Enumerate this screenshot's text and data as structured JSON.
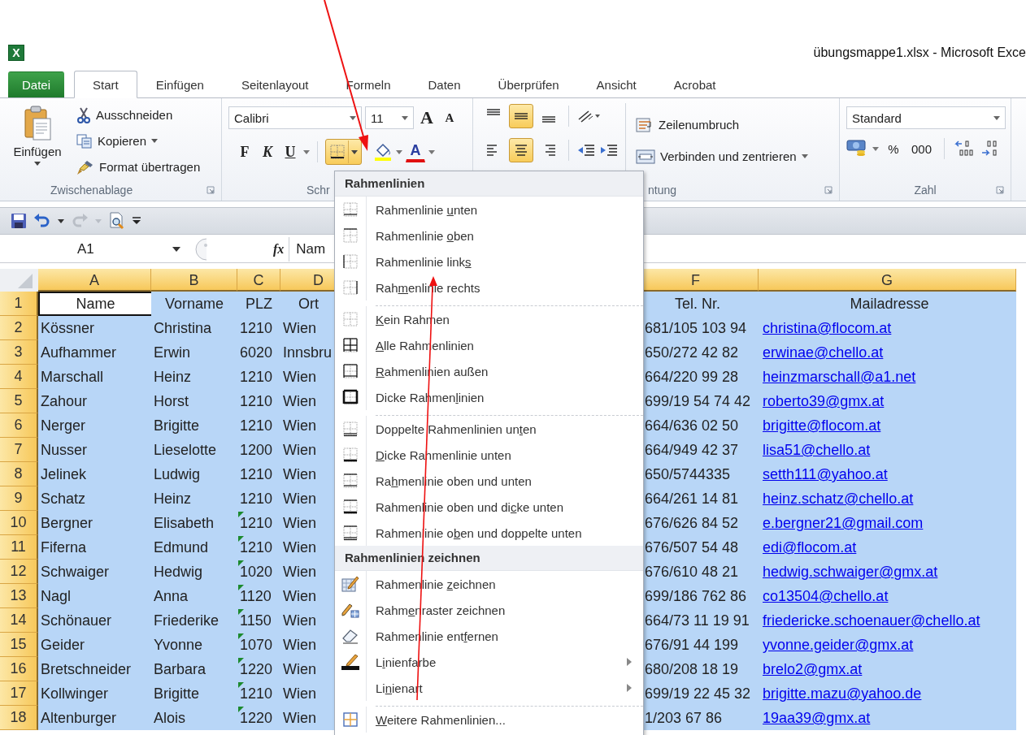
{
  "window": {
    "app_letter": "X",
    "title": "übungsmappe1.xlsx  -  Microsoft Exce"
  },
  "tabs": [
    {
      "label": "Datei",
      "kind": "file",
      "selected": false
    },
    {
      "label": "Start",
      "kind": "tab",
      "selected": true
    },
    {
      "label": "Einfügen",
      "kind": "tab",
      "selected": false
    },
    {
      "label": "Seitenlayout",
      "kind": "tab",
      "selected": false
    },
    {
      "label": "Formeln",
      "kind": "tab",
      "selected": false
    },
    {
      "label": "Daten",
      "kind": "tab",
      "selected": false
    },
    {
      "label": "Überprüfen",
      "kind": "tab",
      "selected": false
    },
    {
      "label": "Ansicht",
      "kind": "tab",
      "selected": false
    },
    {
      "label": "Acrobat",
      "kind": "tab",
      "selected": false
    }
  ],
  "clipboard": {
    "paste": "Einfügen",
    "cut": "Ausschneiden",
    "copy": "Kopieren",
    "format_painter": "Format übertragen",
    "label": "Zwischenablage"
  },
  "font": {
    "family": "Calibri",
    "size": "11",
    "grow": "A",
    "shrink": "A",
    "bold": "F",
    "italic": "K",
    "underline": "U",
    "font_color": "A",
    "borders_open": true,
    "label": "Schr"
  },
  "alignment": {
    "vertical": [
      {
        "kind": "top",
        "selected": false
      },
      {
        "kind": "middle",
        "selected": true
      },
      {
        "kind": "bottom",
        "selected": false
      }
    ],
    "horizontal": [
      {
        "kind": "left",
        "selected": false
      },
      {
        "kind": "center",
        "selected": true
      },
      {
        "kind": "right",
        "selected": false
      }
    ],
    "wrap": "Zeilenumbruch",
    "merge": "Verbinden und zentrieren",
    "label": "ntung"
  },
  "number": {
    "format": "Standard",
    "percent": "%",
    "thousands": "000",
    "label": "Zahl"
  },
  "formula_bar": {
    "name_box": "A1",
    "fx": "fx",
    "value": "Nam"
  },
  "sheet": {
    "columns": [
      {
        "label": "A",
        "kind": "text"
      },
      {
        "label": "B",
        "kind": "text"
      },
      {
        "label": "C",
        "kind": "text"
      },
      {
        "label": "D",
        "kind": "text"
      },
      {
        "label": "F",
        "kind": "text"
      },
      {
        "label": "G",
        "kind": "link"
      }
    ],
    "rows": [
      {
        "label": "1",
        "kind": "header",
        "first_cell_active": true,
        "plz_flag": false,
        "cells": [
          "Name",
          "Vorname",
          "PLZ",
          "Ort",
          "Tel. Nr.",
          "Mailadresse"
        ]
      },
      {
        "label": "2",
        "kind": "data",
        "first_cell_active": false,
        "plz_flag": false,
        "cells": [
          "Kössner",
          "Christina",
          "1210",
          "Wien",
          "681/105 103 94",
          "christina@flocom.at"
        ]
      },
      {
        "label": "3",
        "kind": "data",
        "first_cell_active": false,
        "plz_flag": false,
        "cells": [
          "Aufhammer",
          "Erwin",
          "6020",
          "Innsbru",
          "650/272 42 82",
          "erwinae@chello.at"
        ]
      },
      {
        "label": "4",
        "kind": "data",
        "first_cell_active": false,
        "plz_flag": false,
        "cells": [
          "Marschall",
          "Heinz",
          "1210",
          "Wien",
          "664/220 99 28",
          "heinzmarschall@a1.net"
        ]
      },
      {
        "label": "5",
        "kind": "data",
        "first_cell_active": false,
        "plz_flag": false,
        "cells": [
          "Zahour",
          "Horst",
          "1210",
          "Wien",
          "699/19 54 74 42",
          "roberto39@gmx.at"
        ]
      },
      {
        "label": "6",
        "kind": "data",
        "first_cell_active": false,
        "plz_flag": false,
        "cells": [
          "Nerger",
          "Brigitte",
          "1210",
          "Wien",
          "664/636 02 50",
          "brigitte@flocom.at"
        ]
      },
      {
        "label": "7",
        "kind": "data",
        "first_cell_active": false,
        "plz_flag": false,
        "cells": [
          "Nusser",
          "Lieselotte",
          "1200",
          "Wien",
          "664/949 42 37",
          "lisa51@chello.at"
        ]
      },
      {
        "label": "8",
        "kind": "data",
        "first_cell_active": false,
        "plz_flag": false,
        "cells": [
          "Jelinek",
          "Ludwig",
          "1210",
          "Wien",
          "650/5744335",
          "setth111@yahoo.at"
        ]
      },
      {
        "label": "9",
        "kind": "data",
        "first_cell_active": false,
        "plz_flag": false,
        "cells": [
          "Schatz",
          "Heinz",
          "1210",
          "Wien",
          "664/261 14 81",
          "heinz.schatz@chello.at"
        ]
      },
      {
        "label": "10",
        "kind": "data",
        "first_cell_active": false,
        "plz_flag": true,
        "cells": [
          "Bergner",
          "Elisabeth",
          "1210",
          "Wien",
          "676/626 84 52",
          "e.bergner21@gmail.com"
        ]
      },
      {
        "label": "11",
        "kind": "data",
        "first_cell_active": false,
        "plz_flag": true,
        "cells": [
          "Fiferna",
          "Edmund",
          "1210",
          "Wien",
          "676/507 54 48",
          "edi@flocom.at"
        ]
      },
      {
        "label": "12",
        "kind": "data",
        "first_cell_active": false,
        "plz_flag": true,
        "cells": [
          "Schwaiger",
          "Hedwig",
          "1020",
          "Wien",
          "676/610 48 21",
          "hedwig.schwaiger@gmx.at"
        ]
      },
      {
        "label": "13",
        "kind": "data",
        "first_cell_active": false,
        "plz_flag": true,
        "cells": [
          "Nagl",
          "Anna",
          "1120",
          "Wien",
          "699/186 762 86",
          "co13504@chello.at"
        ]
      },
      {
        "label": "14",
        "kind": "data",
        "first_cell_active": false,
        "plz_flag": true,
        "cells": [
          "Schönauer",
          "Friederike",
          "1150",
          "Wien",
          "664/73 11 19 91",
          "friedericke.schoenauer@chello.at"
        ]
      },
      {
        "label": "15",
        "kind": "data",
        "first_cell_active": false,
        "plz_flag": true,
        "cells": [
          "Geider",
          "Yvonne",
          "1070",
          "Wien",
          "676/91 44 199",
          "yvonne.geider@gmx.at"
        ]
      },
      {
        "label": "16",
        "kind": "data",
        "first_cell_active": false,
        "plz_flag": true,
        "cells": [
          "Bretschneider",
          "Barbara",
          "1220",
          "Wien",
          "680/208 18 19",
          "brelo2@gmx.at"
        ]
      },
      {
        "label": "17",
        "kind": "data",
        "first_cell_active": false,
        "plz_flag": true,
        "cells": [
          "Kollwinger",
          "Brigitte",
          "1210",
          "Wien",
          "699/19 22 45 32",
          "brigitte.mazu@yahoo.de"
        ]
      },
      {
        "label": "18",
        "kind": "data",
        "first_cell_active": false,
        "plz_flag": true,
        "cells": [
          "Altenburger",
          "Alois",
          "1220",
          "Wien",
          "1/203 67 86",
          "19aa39@gmx.at"
        ]
      }
    ]
  },
  "menu": {
    "sections": [
      {
        "title": "Rahmenlinien",
        "items": [
          {
            "kind": "bottom",
            "pre": "Rahmenlinie ",
            "key": "u",
            "post": "nten",
            "separator_before": false,
            "submenu": false
          },
          {
            "kind": "top",
            "pre": "Rahmenlinie ",
            "key": "o",
            "post": "ben",
            "separator_before": false,
            "submenu": false
          },
          {
            "kind": "left",
            "pre": "Rahmenlinie link",
            "key": "s",
            "separator_before": false,
            "submenu": false
          },
          {
            "kind": "right",
            "pre": "Rah",
            "key": "m",
            "post": "enlinie rechts",
            "separator_before": false,
            "submenu": false
          },
          {
            "kind": "none",
            "key": "K",
            "post": "ein Rahmen",
            "separator_before": true,
            "submenu": false
          },
          {
            "kind": "all",
            "key": "A",
            "post": "lle Rahmenlinien",
            "separator_before": false,
            "submenu": false
          },
          {
            "kind": "outside",
            "key": "R",
            "post": "ahmenlinien außen",
            "separator_before": false,
            "submenu": false
          },
          {
            "kind": "thick",
            "pre": "Dicke Rahmen",
            "key": "l",
            "post": "inien",
            "separator_before": false,
            "submenu": false
          },
          {
            "kind": "double-bottom",
            "pre": "Doppelte Rahmenlinien un",
            "key": "t",
            "post": "en",
            "separator_before": true,
            "submenu": false
          },
          {
            "kind": "thick-bottom",
            "key": "D",
            "post": "icke Rahmenlinie unten",
            "separator_before": false,
            "submenu": false
          },
          {
            "kind": "top-bottom",
            "pre": "Ra",
            "key": "h",
            "post": "menlinie oben und unten",
            "separator_before": false,
            "submenu": false
          },
          {
            "kind": "top-thick-bottom",
            "pre": "Rahmenlinie oben und di",
            "key": "c",
            "post": "ke unten",
            "separator_before": false,
            "submenu": false
          },
          {
            "kind": "top-double-bottom",
            "pre": "Rahmenlinie o",
            "key": "b",
            "post": "en und doppelte unten",
            "separator_before": false,
            "submenu": false
          }
        ]
      },
      {
        "title": "Rahmenlinien zeichnen",
        "items": [
          {
            "kind": "draw",
            "pre": "Rahmenlinie ",
            "key": "z",
            "post": "eichnen",
            "separator_before": false,
            "submenu": false
          },
          {
            "kind": "grid",
            "pre": "Rahm",
            "key": "e",
            "post": "nraster zeichnen",
            "separator_before": false,
            "submenu": false
          },
          {
            "kind": "eraser",
            "pre": "Rahmenlinie ent",
            "key": "f",
            "post": "ernen",
            "separator_before": false,
            "submenu": false
          },
          {
            "kind": "line-color",
            "pre": "L",
            "key": "i",
            "post": "nienfarbe",
            "separator_before": false,
            "submenu": true
          },
          {
            "kind": "plain",
            "pre": "Li",
            "key": "n",
            "post": "ienart",
            "separator_before": false,
            "submenu": true
          },
          {
            "kind": "more",
            "key": "W",
            "post": "eitere Rahmenlinien...",
            "separator_before": true,
            "submenu": false
          }
        ]
      }
    ]
  }
}
